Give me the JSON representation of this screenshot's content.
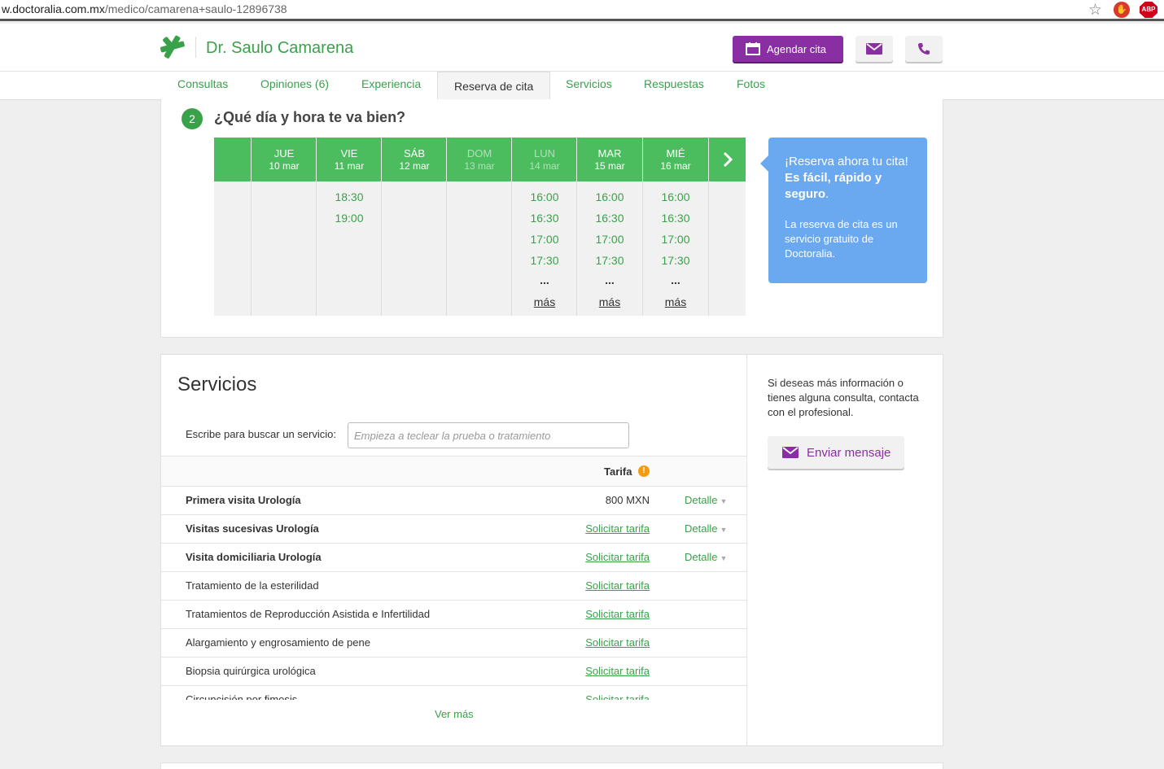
{
  "browser": {
    "url_host": "w.doctoralia.com.mx",
    "url_path": "/medico/camarena+saulo-12896738",
    "ext_adblock_label": "ABP"
  },
  "header": {
    "doctor_name": "Dr. Saulo Camarena",
    "agendar_label": "Agendar cita",
    "brand_color": "#3aa14b",
    "accent_color": "#8a2ea3"
  },
  "tabs": [
    {
      "label": "Consultas"
    },
    {
      "label": "Opiniones (6)"
    },
    {
      "label": "Experiencia"
    },
    {
      "label": "Reserva de cita",
      "active": true
    },
    {
      "label": "Servicios"
    },
    {
      "label": "Respuestas"
    },
    {
      "label": "Fotos"
    }
  ],
  "booking": {
    "step_number": "2",
    "title": "¿Qué día y hora te va bien?",
    "days": [
      {
        "name": "JUE",
        "date": "10 mar",
        "slots": []
      },
      {
        "name": "VIE",
        "date": "11 mar",
        "slots": [
          "18:30",
          "19:00"
        ]
      },
      {
        "name": "SÁB",
        "date": "12 mar",
        "slots": []
      },
      {
        "name": "DOM",
        "date": "13 mar",
        "slots": [],
        "dim": true
      },
      {
        "name": "LUN",
        "date": "14 mar",
        "slots": [
          "16:00",
          "16:30",
          "17:00",
          "17:30"
        ],
        "more": "...",
        "more_link": "más",
        "dim": true
      },
      {
        "name": "MAR",
        "date": "15 mar",
        "slots": [
          "16:00",
          "16:30",
          "17:00",
          "17:30"
        ],
        "more": "...",
        "more_link": "más"
      },
      {
        "name": "MIÉ",
        "date": "16 mar",
        "slots": [
          "16:00",
          "16:30",
          "17:00",
          "17:30"
        ],
        "more": "...",
        "more_link": "más"
      }
    ],
    "bubble": {
      "line1_pre": "¡Reserva ahora tu cita! ",
      "line1_bold": "Es fácil, rápido y seguro",
      "line1_post": ".",
      "line2": "La reserva de cita es un servicio gratuito de Doctoralia."
    }
  },
  "services": {
    "title": "Servicios",
    "search_label": "Escribe para buscar un servicio:",
    "search_placeholder": "Empieza a teclear la prueba o tratamiento",
    "tarifa_header": "Tarifa",
    "info_glyph": "!",
    "rows": [
      {
        "name": "Primera visita Urología",
        "bold": true,
        "price": "800 MXN",
        "detail": "Detalle"
      },
      {
        "name": "Visitas sucesivas Urología",
        "bold": true,
        "request": "Solicitar tarifa",
        "detail": "Detalle"
      },
      {
        "name": "Visita domiciliaria Urología",
        "bold": true,
        "request": "Solicitar tarifa",
        "detail": "Detalle"
      },
      {
        "name": "Tratamiento de la esterilidad",
        "request": "Solicitar tarifa"
      },
      {
        "name": "Tratamientos de Reproducción Asistida e Infertilidad",
        "request": "Solicitar tarifa"
      },
      {
        "name": "Alargamiento y engrosamiento de pene",
        "request": "Solicitar tarifa"
      },
      {
        "name": "Biopsia quirúrgica urológica",
        "request": "Solicitar tarifa"
      },
      {
        "name": "Circuncisión por fimosis",
        "request": "Solicitar tarifa"
      }
    ],
    "ver_mas": "Ver más",
    "side_info": "Si deseas más información o tienes alguna consulta, contacta con el profesional.",
    "send_message": "Enviar mensaje"
  }
}
